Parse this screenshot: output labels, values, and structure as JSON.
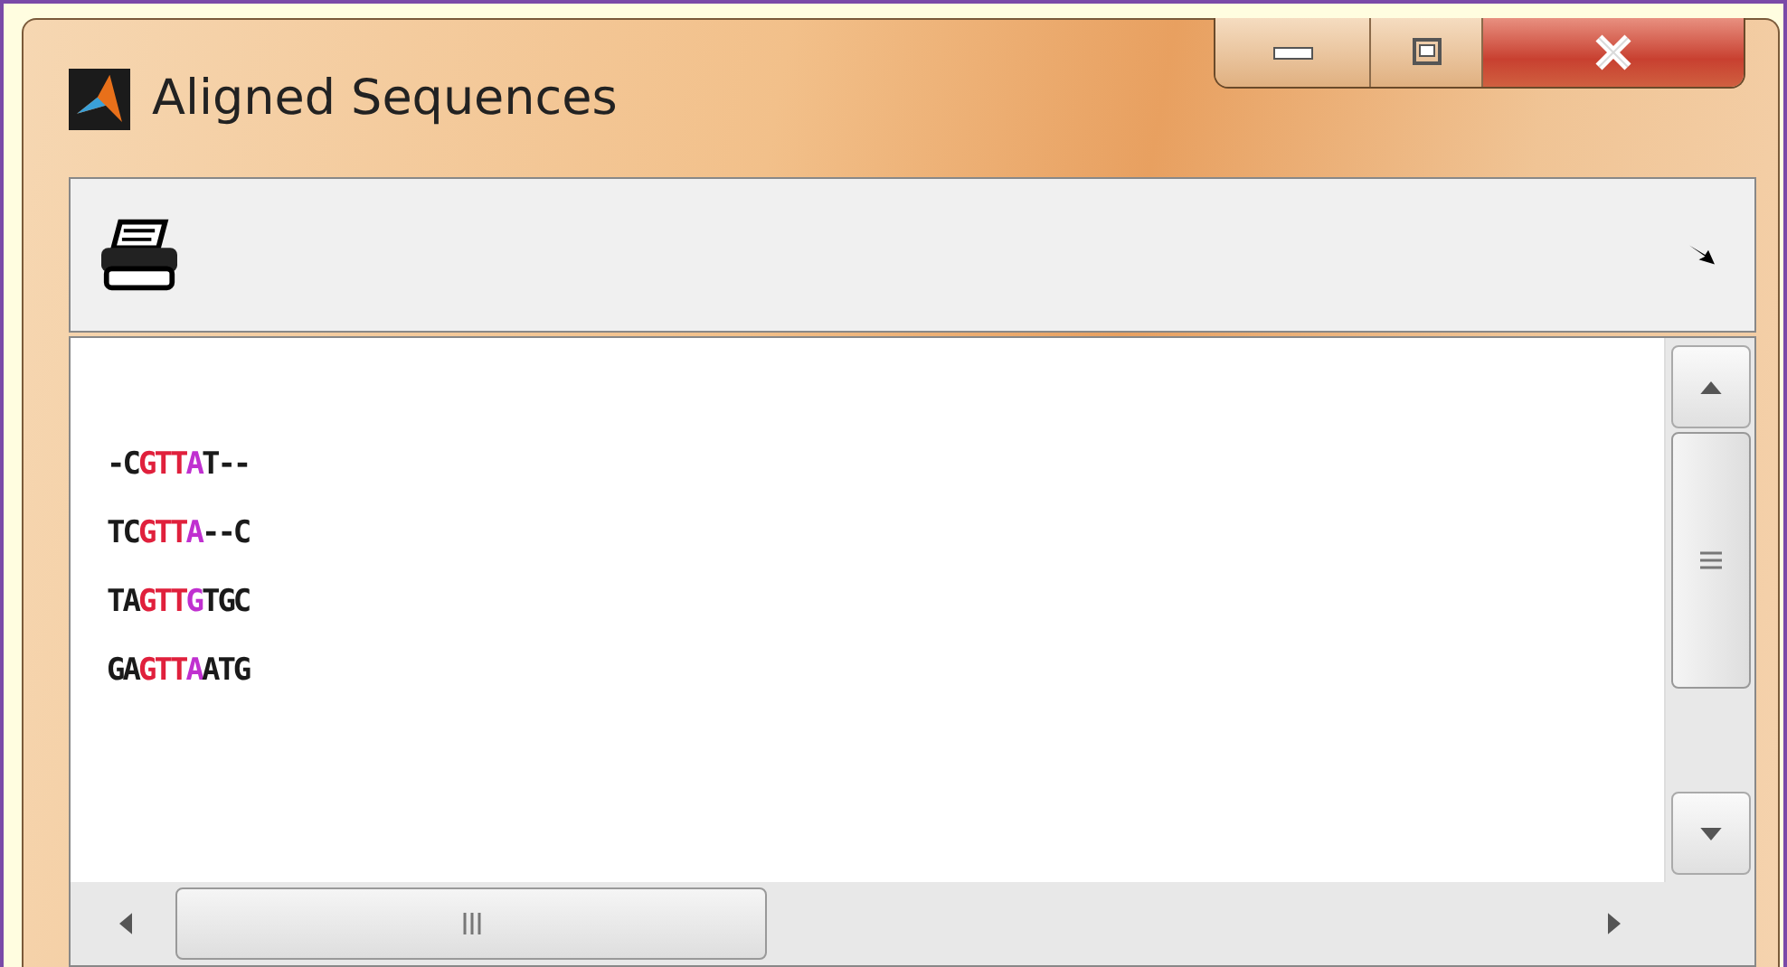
{
  "window": {
    "title": "Aligned Sequences"
  },
  "sequences": [
    [
      {
        "text": "-C",
        "color": "#1a1a1a"
      },
      {
        "text": "GTT",
        "color": "#e0203c"
      },
      {
        "text": "A",
        "color": "#c030d0"
      },
      {
        "text": "T--",
        "color": "#1a1a1a"
      }
    ],
    [
      {
        "text": "TC",
        "color": "#1a1a1a"
      },
      {
        "text": "GTT",
        "color": "#e0203c"
      },
      {
        "text": "A",
        "color": "#c030d0"
      },
      {
        "text": "--C",
        "color": "#1a1a1a"
      }
    ],
    [
      {
        "text": "TA",
        "color": "#1a1a1a"
      },
      {
        "text": "GTT",
        "color": "#e0203c"
      },
      {
        "text": "G",
        "color": "#c030d0"
      },
      {
        "text": "TGC",
        "color": "#1a1a1a"
      }
    ],
    [
      {
        "text": "GA",
        "color": "#1a1a1a"
      },
      {
        "text": "GTT",
        "color": "#e0203c"
      },
      {
        "text": "A",
        "color": "#c030d0"
      },
      {
        "text": "ATG",
        "color": "#1a1a1a"
      }
    ]
  ]
}
